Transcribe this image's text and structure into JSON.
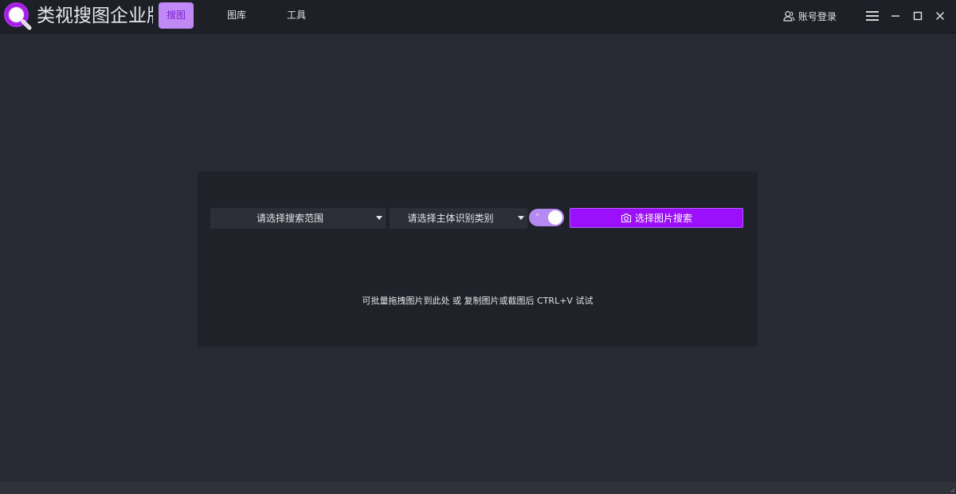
{
  "app": {
    "title": "类视搜图企业版"
  },
  "nav": {
    "tabs": [
      {
        "label": "搜图",
        "active": true
      },
      {
        "label": "图库",
        "active": false
      },
      {
        "label": "工具",
        "active": false
      }
    ]
  },
  "header": {
    "login_label": "账号登录"
  },
  "search": {
    "scope_select": "请选择搜索范围",
    "category_select": "请选择主体识别类别",
    "toggle_on": true,
    "toggle_mark": "〃",
    "button_label": "选择图片搜索",
    "hint": "可批量拖拽图片到此处 或 复制图片或截图后 CTRL+V 试试"
  },
  "colors": {
    "accent": "#9b0ffc",
    "tab_active_bg": "#c089f5",
    "toggle_bg": "#b489f2",
    "background": "#272a33",
    "panel": "#20222a"
  },
  "icons": {
    "logo": "magnifier-logo-icon",
    "login": "user-icon",
    "menu": "menu-icon",
    "minimize": "minimize-icon",
    "maximize": "maximize-icon",
    "close": "close-icon",
    "search_button": "camera-icon"
  }
}
